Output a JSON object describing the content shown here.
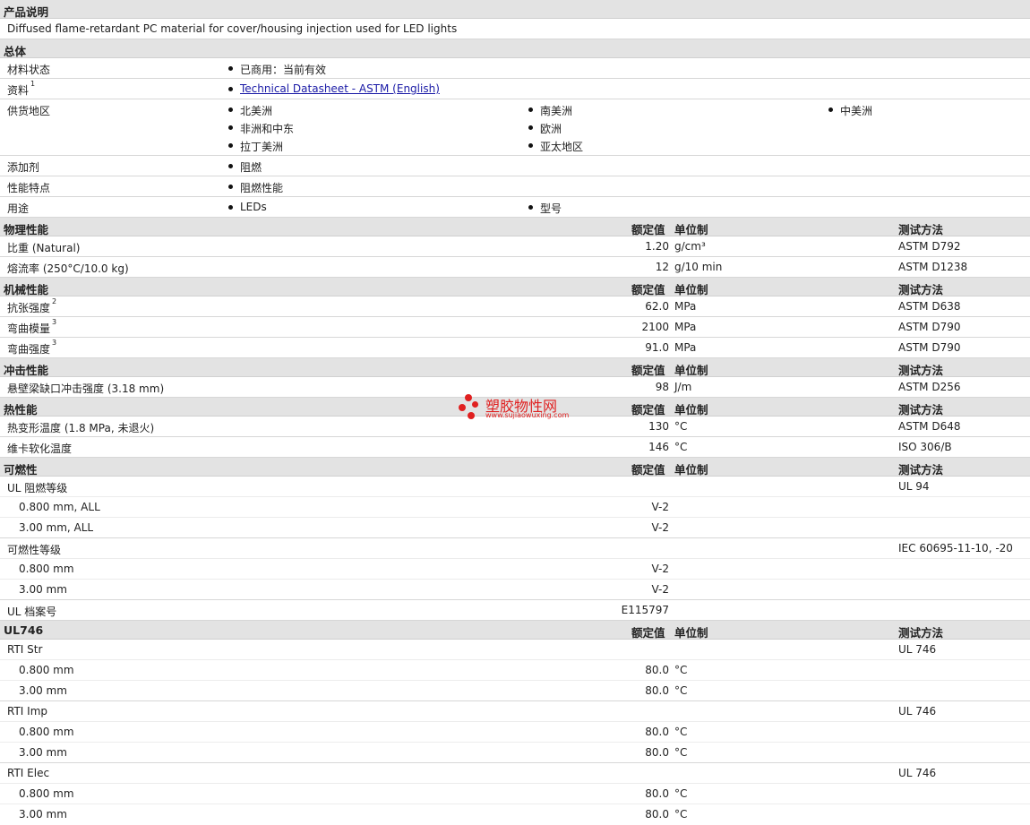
{
  "sections": {
    "desc": "产品说明",
    "general": "总体",
    "physical": "物理性能",
    "mechanical": "机械性能",
    "impact": "冲击性能",
    "thermal": "热性能",
    "flammability": "可燃性",
    "ul746": "UL746"
  },
  "headers": {
    "nominal": "额定值",
    "unit": "单位制",
    "method": "测试方法"
  },
  "description": "Diffused flame-retardant PC material for cover/housing injection used for LED lights",
  "general": {
    "status_label": "材料状态",
    "status_value": "已商用：当前有效",
    "docs_label": "资料",
    "docs_sup": "1",
    "docs_link": "Technical Datasheet - ASTM (English)",
    "supply_label": "供货地区",
    "supply": [
      "北美洲",
      "南美洲",
      "中美洲",
      "非洲和中东",
      "欧洲",
      "拉丁美洲",
      "亚太地区"
    ],
    "additive_label": "添加剂",
    "additive_value": "阻燃",
    "features_label": "性能特点",
    "features_value": "阻燃性能",
    "uses_label": "用途",
    "uses": [
      "LEDs",
      "型号"
    ]
  },
  "physical": [
    {
      "name": "比重",
      "cond": "(Natural)",
      "value": "1.20",
      "unit": "g/cm³",
      "method": "ASTM D792"
    },
    {
      "name": "熔流率",
      "cond": "(250°C/10.0 kg)",
      "value": "12",
      "unit": "g/10 min",
      "method": "ASTM D1238"
    }
  ],
  "mechanical": [
    {
      "name": "抗张强度",
      "sup": "2",
      "value": "62.0",
      "unit": "MPa",
      "method": "ASTM D638"
    },
    {
      "name": "弯曲模量",
      "sup": "3",
      "value": "2100",
      "unit": "MPa",
      "method": "ASTM D790"
    },
    {
      "name": "弯曲强度",
      "sup": "3",
      "value": "91.0",
      "unit": "MPa",
      "method": "ASTM D790"
    }
  ],
  "impact": [
    {
      "name": "悬壁梁缺口冲击强度",
      "cond": "(3.18 mm)",
      "value": "98",
      "unit": "J/m",
      "method": "ASTM D256"
    }
  ],
  "thermal": [
    {
      "name": "热变形温度",
      "cond": "(1.8 MPa, 未退火)",
      "value": "130",
      "unit": "°C",
      "method": "ASTM D648"
    },
    {
      "name": "维卡软化温度",
      "value": "146",
      "unit": "°C",
      "method": "ISO 306/B"
    }
  ],
  "flammability": {
    "ul94_label": "UL 阻燃等级",
    "ul94_method": "UL 94",
    "ul94_rows": [
      {
        "name": "0.800 mm, ALL",
        "value": "V-2"
      },
      {
        "name": "3.00 mm, ALL",
        "value": "V-2"
      }
    ],
    "flam_label": "可燃性等级",
    "flam_method": "IEC 60695-11-10, -20",
    "flam_rows": [
      {
        "name": "0.800 mm",
        "value": "V-2"
      },
      {
        "name": "3.00 mm",
        "value": "V-2"
      }
    ],
    "file_label": "UL 档案号",
    "file_value": "E115797"
  },
  "ul746": {
    "groups": [
      {
        "label": "RTI Str",
        "method": "UL 746",
        "rows": [
          {
            "name": "0.800 mm",
            "value": "80.0",
            "unit": "°C"
          },
          {
            "name": "3.00 mm",
            "value": "80.0",
            "unit": "°C"
          }
        ]
      },
      {
        "label": "RTI Imp",
        "method": "UL 746",
        "rows": [
          {
            "name": "0.800 mm",
            "value": "80.0",
            "unit": "°C"
          },
          {
            "name": "3.00 mm",
            "value": "80.0",
            "unit": "°C"
          }
        ]
      },
      {
        "label": "RTI Elec",
        "method": "UL 746",
        "rows": [
          {
            "name": "0.800 mm",
            "value": "80.0",
            "unit": "°C"
          },
          {
            "name": "3.00 mm",
            "value": "80.0",
            "unit": "°C"
          }
        ]
      }
    ]
  },
  "watermark": {
    "text": "塑胶物性网",
    "url": "www.sujiaowuxing.com",
    "color": "#e02020"
  }
}
